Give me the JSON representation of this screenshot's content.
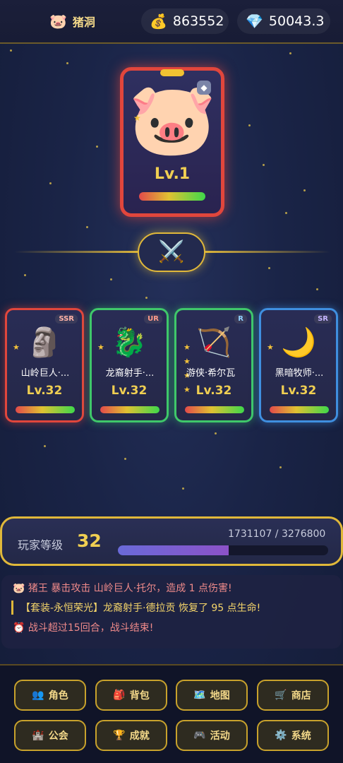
{
  "topbar": {
    "location": "猪洞",
    "location_icon": "🐷",
    "gold": "863552",
    "gold_icon": "💰",
    "gems": "50043.3",
    "gem_icon": "💎"
  },
  "hero": {
    "portrait": "🐷",
    "level": "Lv.1",
    "hp_fraction": 1.0
  },
  "vs_icon": "⚔️",
  "team": [
    {
      "name": "山岭巨人·...",
      "level": "Lv.32",
      "rarity": "SSR",
      "icon": "🗿",
      "stars": 1,
      "hp_fraction": 1.0
    },
    {
      "name": "龙裔射手·...",
      "level": "Lv.32",
      "rarity": "UR",
      "icon": "🐉",
      "stars": 1,
      "hp_fraction": 1.0
    },
    {
      "name": "游侠·希尔瓦",
      "level": "Lv.32",
      "rarity": "R",
      "icon": "🏹",
      "stars": 4,
      "hp_fraction": 1.0
    },
    {
      "name": "黑暗牧师·...",
      "level": "Lv.32",
      "rarity": "SR",
      "icon": "🌙",
      "stars": 1,
      "hp_fraction": 1.0
    }
  ],
  "player": {
    "label": "玩家等级",
    "level": "32",
    "xp_text": "1731107 / 3276800",
    "xp_fraction": 0.528
  },
  "log": [
    "🐷 猪王 暴击攻击 山岭巨人·托尔，造成 1 点伤害!",
    "【套装-永恒荣光】龙裔射手·德拉贡 恢复了 95 点生命!",
    "⏰ 战斗超过15回合，战斗结束!"
  ],
  "nav": [
    {
      "label": "角色",
      "icon": "👥"
    },
    {
      "label": "背包",
      "icon": "🎒"
    },
    {
      "label": "地图",
      "icon": "🗺️"
    },
    {
      "label": "商店",
      "icon": "🛒"
    },
    {
      "label": "公会",
      "icon": "🏰"
    },
    {
      "label": "成就",
      "icon": "🏆"
    },
    {
      "label": "活动",
      "icon": "🎮"
    },
    {
      "label": "系统",
      "icon": "⚙️"
    }
  ],
  "colors": {
    "gold_accent": "#e0b83a",
    "ssr_border": "#e1463c",
    "ur_border": "#3fc86a",
    "r_border": "#3fc86a",
    "sr_border": "#3f8fe0"
  }
}
